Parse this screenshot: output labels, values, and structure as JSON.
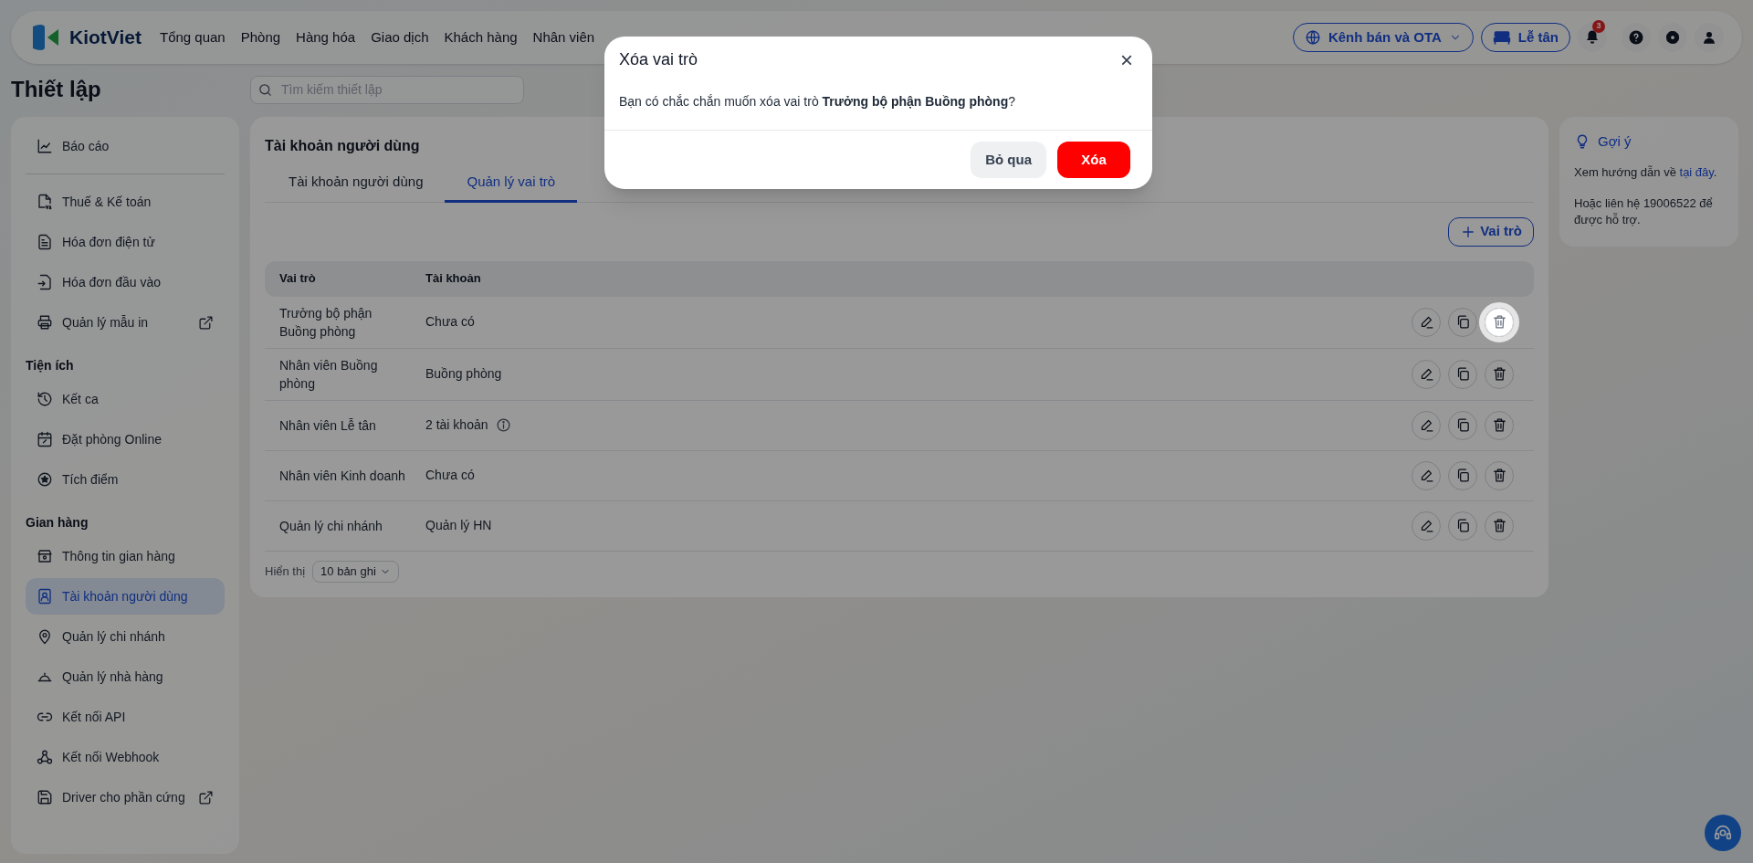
{
  "navbar": {
    "logo": "KiotViet",
    "menu": [
      "Tổng quan",
      "Phòng",
      "Hàng hóa",
      "Giao dịch",
      "Khách hàng",
      "Nhân viên"
    ],
    "channel_button": "Kênh bán và OTA",
    "reception_button": "Lễ tân",
    "notification_count": "3"
  },
  "page_title": "Thiết lập",
  "search": {
    "placeholder": "Tìm kiếm thiết lập"
  },
  "sidebar": {
    "sections": [
      {
        "items": [
          {
            "label": "Báo cáo",
            "external": false,
            "selected": false
          }
        ]
      },
      {
        "items": [
          {
            "label": "Thuế & Kế toán",
            "external": false,
            "selected": false
          },
          {
            "label": "Hóa đơn điện tử",
            "external": false,
            "selected": false
          },
          {
            "label": "Hóa đơn đầu vào",
            "external": false,
            "selected": false
          },
          {
            "label": "Quản lý mẫu in",
            "external": true,
            "selected": false
          }
        ]
      },
      {
        "heading": "Tiện ích",
        "items": [
          {
            "label": "Kết ca",
            "external": false,
            "selected": false
          },
          {
            "label": "Đặt phòng Online",
            "external": false,
            "selected": false
          },
          {
            "label": "Tích điểm",
            "external": false,
            "selected": false
          }
        ]
      },
      {
        "heading": "Gian hàng",
        "items": [
          {
            "label": "Thông tin gian hàng",
            "external": false,
            "selected": false
          },
          {
            "label": "Tài khoản người dùng",
            "external": false,
            "selected": true
          },
          {
            "label": "Quản lý chi nhánh",
            "external": false,
            "selected": false
          },
          {
            "label": "Quản lý nhà hàng",
            "external": false,
            "selected": false
          },
          {
            "label": "Kết nối API",
            "external": false,
            "selected": false
          },
          {
            "label": "Kết nối Webhook",
            "external": false,
            "selected": false
          },
          {
            "label": "Driver cho phần cứng",
            "external": true,
            "selected": false
          }
        ]
      }
    ]
  },
  "main": {
    "title": "Tài khoản người dùng",
    "tabs": [
      {
        "label": "Tài khoản người dùng",
        "selected": false
      },
      {
        "label": "Quản lý vai trò",
        "selected": true
      }
    ],
    "add_button": "Vai trò",
    "table": {
      "columns": [
        "Vai trò",
        "Tài khoản"
      ],
      "rows": [
        {
          "role": "Trưởng bộ phận Buồng phòng",
          "account": "Chưa có",
          "info": false,
          "delete_highlighted": true
        },
        {
          "role": "Nhân viên Buồng phòng",
          "account": "Buồng phòng",
          "info": false,
          "delete_highlighted": false
        },
        {
          "role": "Nhân viên Lễ tân",
          "account": "2 tài khoản",
          "info": true,
          "delete_highlighted": false
        },
        {
          "role": "Nhân viên Kinh doanh",
          "account": "Chưa có",
          "info": false,
          "delete_highlighted": false
        },
        {
          "role": "Quản lý chi nhánh",
          "account": "Quản lý HN",
          "info": false,
          "delete_highlighted": false
        }
      ]
    },
    "page_size_label": "Hiển thị",
    "page_size": "10 bản ghi"
  },
  "tips": {
    "title": "Gợi ý",
    "guide_text": "Xem hướng dẫn về ",
    "guide_link": "tại đây",
    "guide_end": ".",
    "contact": "Hoặc liên hệ 19006522 để được hỗ trợ."
  },
  "dialog": {
    "title": "Xóa vai trò",
    "close": "×",
    "message": "Bạn có chắc chắn muốn xóa vai trò **Trưởng bộ phận Buồng phòng**?",
    "cancel": "Bỏ qua",
    "confirm": "Xóa"
  }
}
